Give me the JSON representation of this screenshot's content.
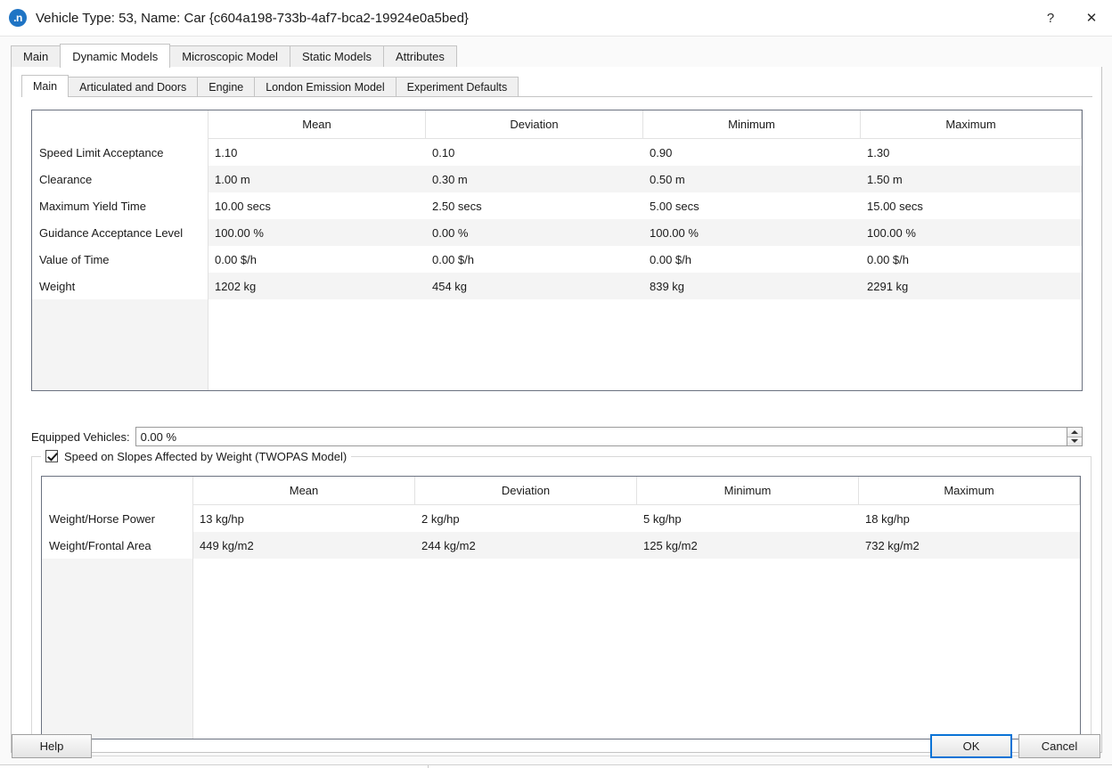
{
  "window": {
    "icon": "aimsun-app-icon",
    "title": "Vehicle Type: 53, Name: Car  {c604a198-733b-4af7-bca2-19924e0a5bed}",
    "help_button": "?",
    "close_button": "✕"
  },
  "outer_tabs": [
    {
      "label": "Main",
      "active": false
    },
    {
      "label": "Dynamic Models",
      "active": true
    },
    {
      "label": "Microscopic Model",
      "active": false
    },
    {
      "label": "Static Models",
      "active": false
    },
    {
      "label": "Attributes",
      "active": false
    }
  ],
  "inner_tabs": [
    {
      "label": "Main",
      "active": true
    },
    {
      "label": "Articulated and Doors",
      "active": false
    },
    {
      "label": "Engine",
      "active": false
    },
    {
      "label": "London Emission Model",
      "active": false
    },
    {
      "label": "Experiment Defaults",
      "active": false
    }
  ],
  "main_table": {
    "columns": [
      "",
      "Mean",
      "Deviation",
      "Minimum",
      "Maximum"
    ],
    "rows": [
      {
        "label": "Speed Limit Acceptance",
        "mean": "1.10",
        "deviation": "0.10",
        "minimum": "0.90",
        "maximum": "1.30"
      },
      {
        "label": "Clearance",
        "mean": "1.00 m",
        "deviation": "0.30 m",
        "minimum": "0.50 m",
        "maximum": "1.50 m"
      },
      {
        "label": "Maximum Yield Time",
        "mean": "10.00 secs",
        "deviation": "2.50 secs",
        "minimum": "5.00 secs",
        "maximum": "15.00 secs"
      },
      {
        "label": "Guidance Acceptance Level",
        "mean": "100.00 %",
        "deviation": "0.00 %",
        "minimum": "100.00 %",
        "maximum": "100.00 %"
      },
      {
        "label": "Value of Time",
        "mean": "0.00 $/h",
        "deviation": "0.00 $/h",
        "minimum": "0.00 $/h",
        "maximum": "0.00 $/h"
      },
      {
        "label": "Weight",
        "mean": "1202 kg",
        "deviation": "454 kg",
        "minimum": "839 kg",
        "maximum": "2291 kg"
      }
    ]
  },
  "equipped_vehicles": {
    "label": "Equipped Vehicles:",
    "value": "0.00 %",
    "placeholder": "0.00 %",
    "spinner_up": "spinner-up-icon",
    "spinner_down": "spinner-down-icon"
  },
  "twopas_group": {
    "checkbox_checked": true,
    "legend": "Speed on Slopes Affected by Weight (TWOPAS Model)",
    "table": {
      "columns": [
        "",
        "Mean",
        "Deviation",
        "Minimum",
        "Maximum"
      ],
      "rows": [
        {
          "label": "Weight/Horse Power",
          "mean": "13 kg/hp",
          "deviation": "2 kg/hp",
          "minimum": "5 kg/hp",
          "maximum": "18 kg/hp"
        },
        {
          "label": "Weight/Frontal Area",
          "mean": "449 kg/m2",
          "deviation": "244 kg/m2",
          "minimum": "125 kg/m2",
          "maximum": "732 kg/m2"
        }
      ]
    }
  },
  "footer": {
    "help": "Help",
    "ok": "OK",
    "cancel": "Cancel"
  },
  "colors": {
    "accent": "#0a73d6",
    "app_icon": "#1f74c4",
    "row_alt": "#f4f4f4",
    "grid_border": "#6b7280"
  }
}
